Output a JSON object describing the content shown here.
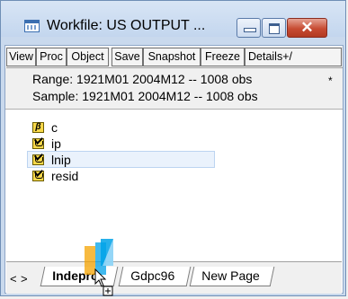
{
  "window": {
    "title": "Workfile: US OUTPUT ...",
    "controls": {
      "minimize": "minimize",
      "maximize": "maximize",
      "close": "✕"
    }
  },
  "toolbar": [
    "View",
    "Proc",
    "Object",
    "Save",
    "Snapshot",
    "Freeze",
    "Details+/"
  ],
  "info": {
    "range": "Range:  1921M01 2004M12  --  1008 obs",
    "sample": "Sample: 1921M01 2004M12  --  1008 obs",
    "modified_marker": "*"
  },
  "objects": [
    {
      "name": "c",
      "icon": "coefficient-icon",
      "icon_text": "β"
    },
    {
      "name": "ip",
      "icon": "series-icon"
    },
    {
      "name": "lnip",
      "icon": "series-icon",
      "selected": true
    },
    {
      "name": "resid",
      "icon": "series-icon"
    }
  ],
  "tabs": {
    "prev": "<",
    "next": ">",
    "items": [
      "Indepro",
      "Gdpc96",
      "New Page"
    ],
    "active": "Indepro"
  },
  "colors": {
    "accent": "#3b6fb1",
    "selection": "#eaf2fc",
    "close": "#c74b32"
  }
}
